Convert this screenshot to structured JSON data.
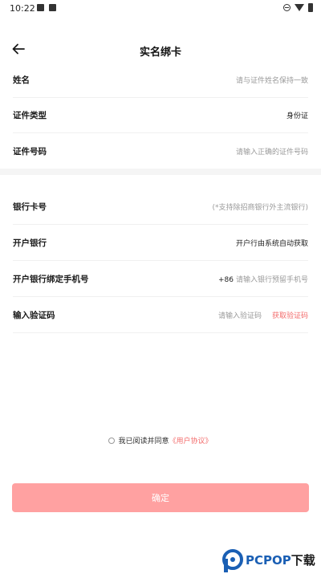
{
  "status_bar": {
    "time": "10:22"
  },
  "header": {
    "title": "实名绑卡"
  },
  "identity_section": {
    "name_label": "姓名",
    "name_placeholder": "请与证件姓名保持一致",
    "id_type_label": "证件类型",
    "id_type_value": "身份证",
    "id_number_label": "证件号码",
    "id_number_placeholder": "请输入正确的证件号码"
  },
  "bank_section": {
    "card_label": "银行卡号",
    "card_placeholder": "(*支持除招商银行外主流银行)",
    "bank_label": "开户银行",
    "bank_value": "开户行由系统自动获取",
    "phone_label": "开户银行绑定手机号",
    "phone_prefix": "+86",
    "phone_placeholder": "请输入银行预留手机号",
    "code_label": "输入验证码",
    "code_placeholder": "请输入验证码",
    "get_code_label": "获取验证码"
  },
  "agreement": {
    "text": "我已阅读并同意",
    "link": "《用户协议》"
  },
  "confirm_button": {
    "label": "确定"
  },
  "watermark": {
    "text": "PCPOP",
    "suffix": "下载"
  },
  "colors": {
    "accent": "#f36c6c",
    "button_disabled": "#ffa1a1",
    "divider": "#f5f5f5"
  }
}
